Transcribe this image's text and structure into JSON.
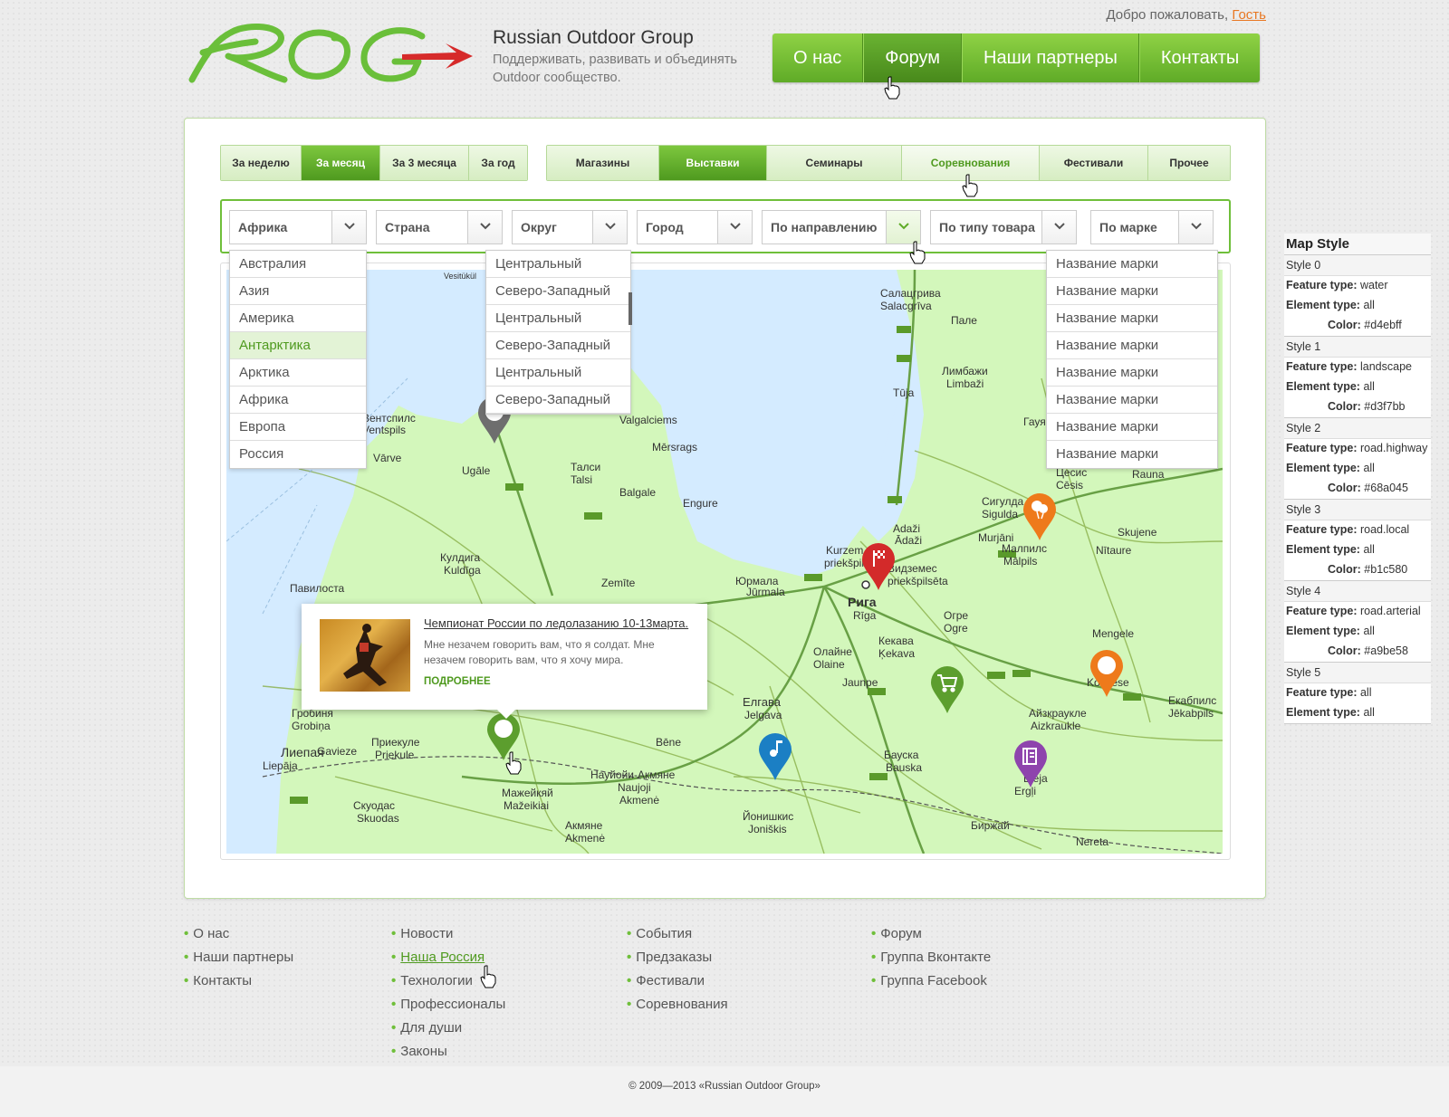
{
  "header": {
    "welcome_text": "Добро пожаловать,",
    "guest_link": "Гость",
    "logo_text": "ROG",
    "brand_name": "Russian Outdoor Group",
    "brand_tagline": "Поддерживать, развивать и объединять Outdoor сообщество.",
    "nav": [
      "О нас",
      "Форум",
      "Наши партнеры",
      "Контакты"
    ],
    "nav_active": "Форум"
  },
  "period_tabs": {
    "items": [
      "За неделю",
      "За месяц",
      "За 3 месяца",
      "За год"
    ],
    "active": "За месяц"
  },
  "category_tabs": {
    "items": [
      "Магазины",
      "Выставки",
      "Семинары",
      "Соревнования",
      "Фестивали",
      "Прочее"
    ],
    "active": "Выставки",
    "hover": "Соревнования"
  },
  "filters": {
    "continent": "Африка",
    "country": "Страна",
    "district": "Округ",
    "city": "Город",
    "direction": "По направлению",
    "product_type": "По типу товара",
    "brand": "По марке"
  },
  "continent_options": [
    "Австралия",
    "Азия",
    "Америка",
    "Антарктика",
    "Арктика",
    "Африка",
    "Европа",
    "Россия"
  ],
  "continent_selected": "Антарктика",
  "district_options": [
    "Центральный",
    "Северо-Западный",
    "Центральный",
    "Северо-Западный",
    "Центральный",
    "Северо-Западный"
  ],
  "brand_options": [
    "Название марки",
    "Название марки",
    "Название марки",
    "Название марки",
    "Название марки",
    "Название марки",
    "Название марки",
    "Название марки"
  ],
  "map": {
    "labels": [
      "Vesitükül",
      "Салацгрива",
      "Salacgrīva",
      "Пале",
      "Лимбажи",
      "Limbaži",
      "Tūja",
      "Гауя",
      "Цесис",
      "Cēsis",
      "Rauna",
      "Вентспилс",
      "Ventspils",
      "Vārve",
      "Ugāle",
      "Valgalciems",
      "Mērsrags",
      "Талси",
      "Talsi",
      "Engure",
      "Balgale",
      "Кулдига",
      "Kuldīga",
      "Zemīte",
      "Павилоста",
      "Юрмала",
      "Jūrmala",
      "Kurzem",
      "priekšpil",
      "Adaži",
      "Ādaži",
      "Сигулда",
      "Sigulda",
      "Murjāni",
      "Малпилс",
      "Mālpils",
      "Nītaure",
      "Skujene",
      "Рига",
      "Rīga",
      "Видземес",
      "priekšpilsēta",
      "Огре",
      "Ogre",
      "Олайне",
      "Olaine",
      "Кекава",
      "Ķekava",
      "Jaunpe",
      "Mengele",
      "Koknese",
      "Гробиня",
      "Grobiņa",
      "Елгава",
      "Jelgava",
      "Aizkraukle",
      "Айзкраукле",
      "Екабпилс",
      "Jēkabpils",
      "Лиепая",
      "Liepāja",
      "Gavieze",
      "Приекуле",
      "Priekule",
      "Bēne",
      "Бауска",
      "Bauska",
      "Науйойи-Акмяне",
      "Naujoji",
      "Akmenė",
      "Ergļi",
      "Мажейкяй",
      "Mažeikiai",
      "Скуодас",
      "Skuodas",
      "Акмяне",
      "Akmenė",
      "Йонишкис",
      "Joniškis",
      "Биржай",
      "Nereta",
      "Eleja"
    ],
    "markers": [
      {
        "name": "gray-generic",
        "color": "#6e6e6e",
        "icon": "circle"
      },
      {
        "name": "red-flag",
        "color": "#d32a2a",
        "icon": "flag"
      },
      {
        "name": "orange-balloon",
        "color": "#ee7a1b",
        "icon": "balloon"
      },
      {
        "name": "orange-generic",
        "color": "#ee7a1b",
        "icon": "circle"
      },
      {
        "name": "green-cart",
        "color": "#5c9e2e",
        "icon": "cart"
      },
      {
        "name": "blue-music",
        "color": "#1b7fc4",
        "icon": "music"
      },
      {
        "name": "purple-book",
        "color": "#8e44ad",
        "icon": "book"
      },
      {
        "name": "green-generic",
        "color": "#5c9e2e",
        "icon": "circle"
      }
    ]
  },
  "popup": {
    "title": "Чемпионат России по ледолазанию 10-13марта.",
    "text": "Мне незачем говорить вам, что я солдат. Мне незачем говорить вам, что я хочу мира.",
    "more": "ПОДРОБНЕЕ"
  },
  "map_style": {
    "title": "Map Style",
    "feature_label": "Feature type:",
    "element_label": "Element type:",
    "color_label": "Color:",
    "styles": [
      {
        "name": "Style 0",
        "feature": "water",
        "element": "all",
        "color": "#d4ebff"
      },
      {
        "name": "Style 1",
        "feature": "landscape",
        "element": "all",
        "color": "#d3f7bb"
      },
      {
        "name": "Style 2",
        "feature": "road.highway",
        "element": "all",
        "color": "#68a045"
      },
      {
        "name": "Style 3",
        "feature": "road.local",
        "element": "all",
        "color": "#b1c580"
      },
      {
        "name": "Style 4",
        "feature": "road.arterial",
        "element": "all",
        "color": "#a9be58"
      },
      {
        "name": "Style 5",
        "feature": "all",
        "element": "all"
      }
    ]
  },
  "footer": {
    "col1": [
      "О нас",
      "Наши партнеры",
      "Контакты"
    ],
    "col2": [
      "Новости",
      "Наша Россия",
      "Технологии",
      "Профессионалы",
      "Для души",
      "Законы"
    ],
    "col3": [
      "События",
      "Предзаказы",
      "Фестивали",
      "Соревнования"
    ],
    "col4": [
      "Форум",
      "Группа Вконтакте",
      "Группа Facebook"
    ],
    "copyright": "© 2009—2013 «Russian Outdoor Group»"
  },
  "colors": {
    "accent": "#5fab27",
    "accent_light": "#8fd245",
    "link_orange": "#e87722",
    "water": "#d4ebff",
    "land": "#d3f7bb",
    "highway": "#68a045"
  }
}
